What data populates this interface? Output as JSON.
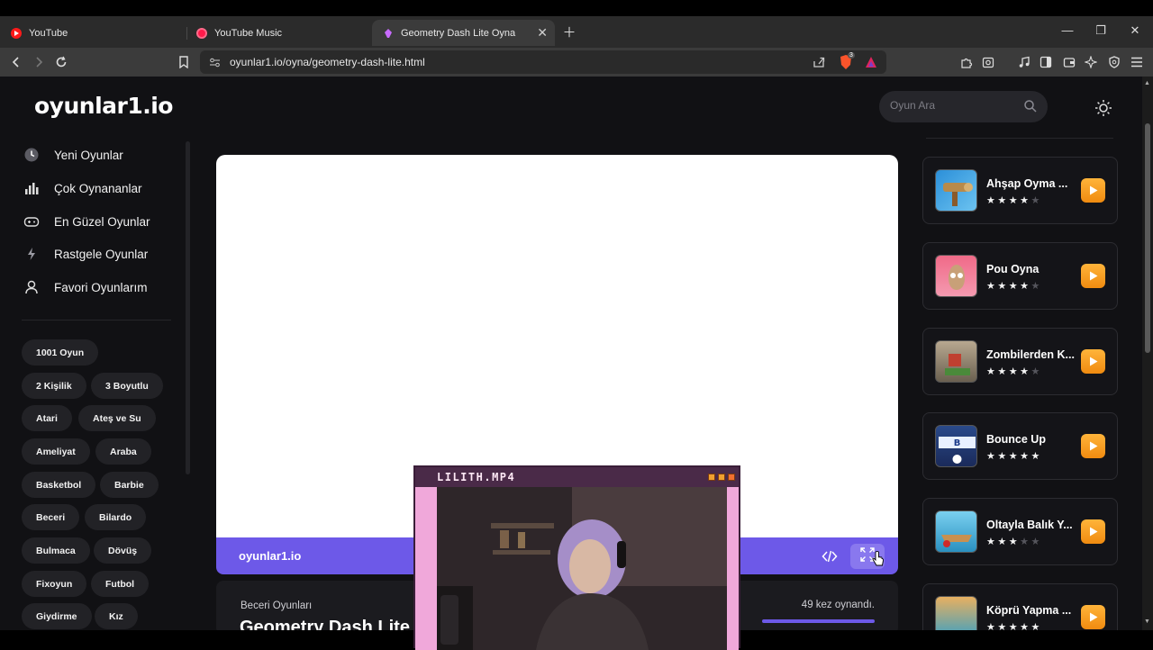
{
  "browser": {
    "tabs": [
      {
        "label": "YouTube",
        "active": false
      },
      {
        "label": "YouTube Music",
        "active": false
      },
      {
        "label": "Geometry Dash Lite Oyna",
        "active": true
      }
    ],
    "url": "oyunlar1.io/oyna/geometry-dash-lite.html",
    "shield_count": "3"
  },
  "site": {
    "logo": "oyunlar1.io",
    "search_placeholder": "Oyun Ara"
  },
  "nav": [
    {
      "label": "Yeni Oyunlar",
      "icon": "clock-icon"
    },
    {
      "label": "Çok Oynananlar",
      "icon": "bar-chart-icon"
    },
    {
      "label": "En Güzel Oyunlar",
      "icon": "gamepad-icon"
    },
    {
      "label": "Rastgele Oyunlar",
      "icon": "lightning-icon"
    },
    {
      "label": "Favori Oyunlarım",
      "icon": "user-icon"
    }
  ],
  "tags": [
    "1001 Oyun",
    "2 Kişilik",
    "3 Boyutlu",
    "Atari",
    "Ateş ve Su",
    "Ameliyat",
    "Araba",
    "Basketbol",
    "Barbie",
    "Beceri",
    "Bilardo",
    "Bulmaca",
    "Dövüş",
    "Fixoyun",
    "Futbol",
    "Giydirme",
    "Kız"
  ],
  "player": {
    "brand": "oyunlar1.io"
  },
  "game_info": {
    "category": "Beceri Oyunları",
    "title": "Geometry Dash Lite",
    "plays": "49 kez oynandı."
  },
  "related_games": [
    {
      "title": "Ahşap Oyma ...",
      "rating": 4
    },
    {
      "title": "Pou Oyna",
      "rating": 4
    },
    {
      "title": "Zombilerden K...",
      "rating": 4
    },
    {
      "title": "Bounce Up",
      "rating": 5
    },
    {
      "title": "Oltayla Balık Y...",
      "rating": 3
    },
    {
      "title": "Köprü Yapma ...",
      "rating": 5
    }
  ],
  "overlay": {
    "title": "LILITH.MP4"
  },
  "colors": {
    "accent": "#6d59e8",
    "play_button": "#f59a1e",
    "page_bg": "#111114"
  }
}
